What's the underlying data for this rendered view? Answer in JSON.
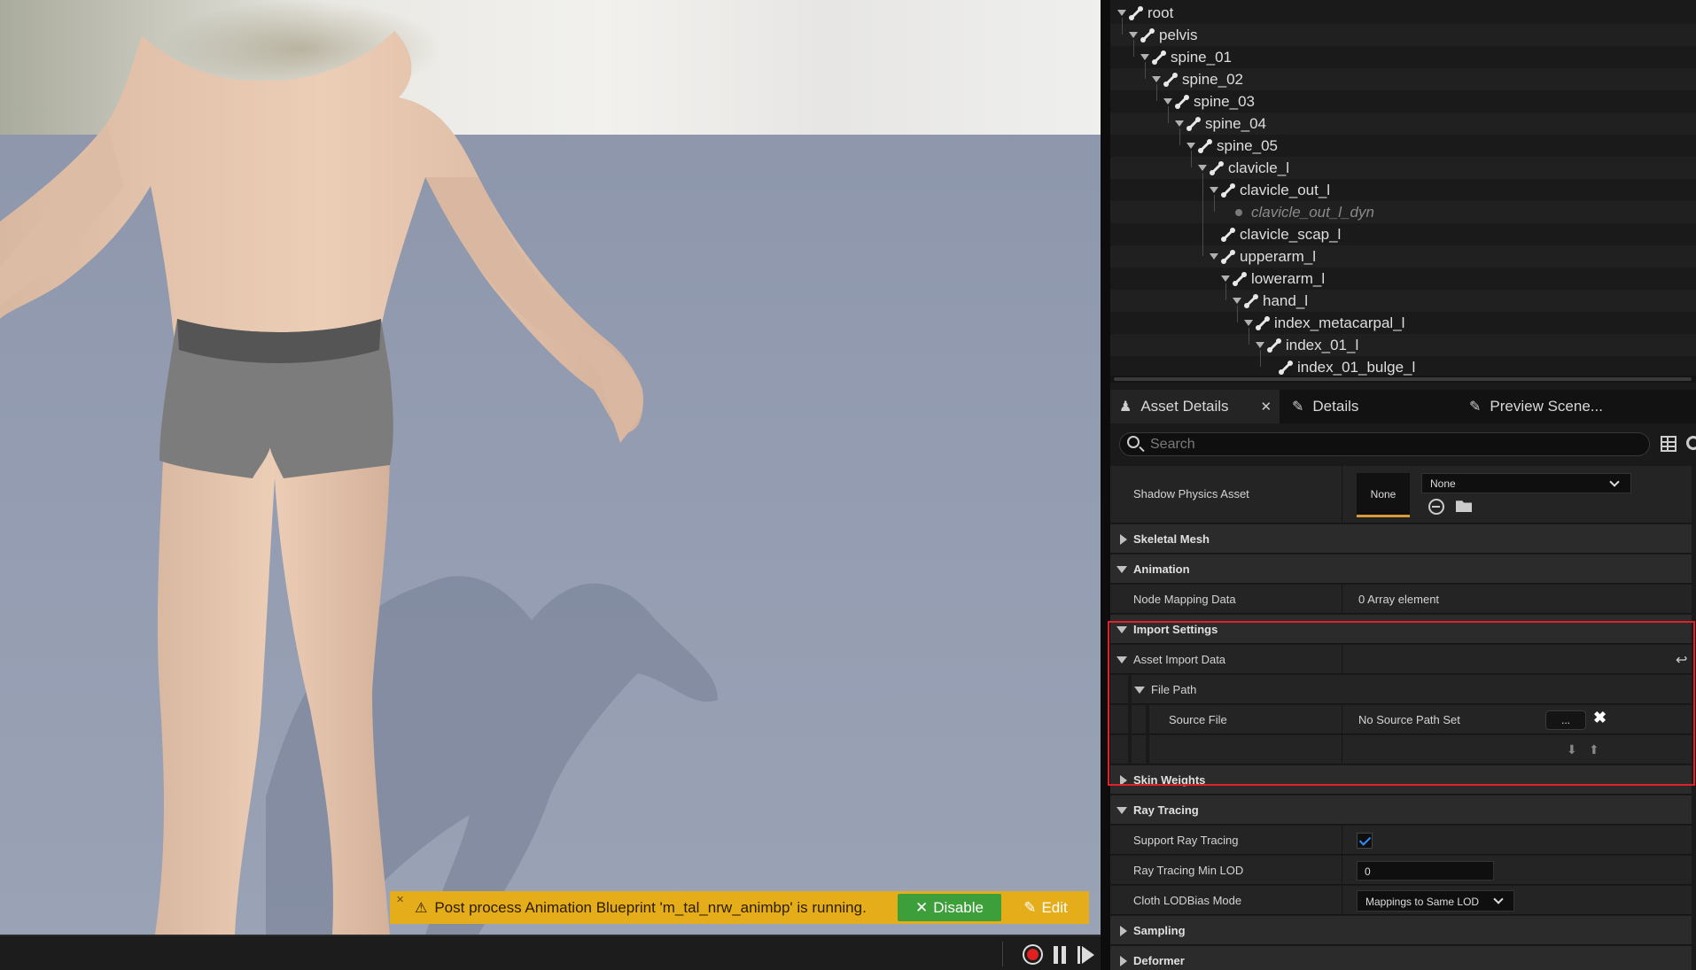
{
  "notification": {
    "message": "Post process Animation Blueprint 'm_tal_nrw_animbp' is running.",
    "disable_label": "Disable",
    "edit_label": "Edit"
  },
  "skeleton_tree": {
    "bones": [
      {
        "name": "root",
        "level": 0,
        "expanded": true
      },
      {
        "name": "pelvis",
        "level": 1,
        "expanded": true
      },
      {
        "name": "spine_01",
        "level": 2,
        "expanded": true
      },
      {
        "name": "spine_02",
        "level": 3,
        "expanded": true
      },
      {
        "name": "spine_03",
        "level": 4,
        "expanded": true
      },
      {
        "name": "spine_04",
        "level": 5,
        "expanded": true
      },
      {
        "name": "spine_05",
        "level": 6,
        "expanded": true
      },
      {
        "name": "clavicle_l",
        "level": 7,
        "expanded": true
      },
      {
        "name": "clavicle_out_l",
        "level": 8,
        "expanded": true
      },
      {
        "name": "clavicle_out_l_dyn",
        "level": 9,
        "virtual": true
      },
      {
        "name": "clavicle_scap_l",
        "level": 8
      },
      {
        "name": "upperarm_l",
        "level": 8,
        "expanded": true
      },
      {
        "name": "lowerarm_l",
        "level": 9,
        "expanded": true
      },
      {
        "name": "hand_l",
        "level": 10,
        "expanded": true
      },
      {
        "name": "index_metacarpal_l",
        "level": 11,
        "expanded": true
      },
      {
        "name": "index_01_l",
        "level": 12,
        "expanded": true
      },
      {
        "name": "index_01_bulge_l",
        "level": 13
      }
    ]
  },
  "tabs": [
    {
      "label": "Asset Details",
      "icon": "asset-details-icon",
      "active": true,
      "closable": true
    },
    {
      "label": "Details",
      "icon": "pencil-icon"
    },
    {
      "label": "Preview Scene...",
      "icon": "preview-scene-icon"
    }
  ],
  "search": {
    "placeholder": "Search"
  },
  "properties": {
    "shadow_physics_asset": {
      "label": "Shadow Physics Asset",
      "thumb": "None",
      "value": "None"
    },
    "skeletal_mesh": "Skeletal Mesh",
    "animation": "Animation",
    "node_mapping_data": {
      "label": "Node Mapping Data",
      "value": "0 Array element"
    },
    "import_settings": "Import Settings",
    "asset_import_data": "Asset Import Data",
    "file_path": "File Path",
    "source_file": {
      "label": "Source File",
      "value": "No Source Path Set",
      "browse": "..."
    },
    "skin_weights": "Skin Weights",
    "ray_tracing": "Ray Tracing",
    "support_ray_tracing": {
      "label": "Support Ray Tracing",
      "checked": true
    },
    "ray_tracing_min_lod": {
      "label": "Ray Tracing Min LOD",
      "value": "0"
    },
    "cloth_lodbias_mode": {
      "label": "Cloth LODBias Mode",
      "value": "Mappings to Same LOD"
    },
    "sampling": "Sampling",
    "deformer": "Deformer"
  },
  "colors": {
    "highlight_box": "#e0212b",
    "notification_bg": "#e6ad1a",
    "disable_button": "#3d9f3a",
    "checkbox_accent": "#2f8fff"
  }
}
